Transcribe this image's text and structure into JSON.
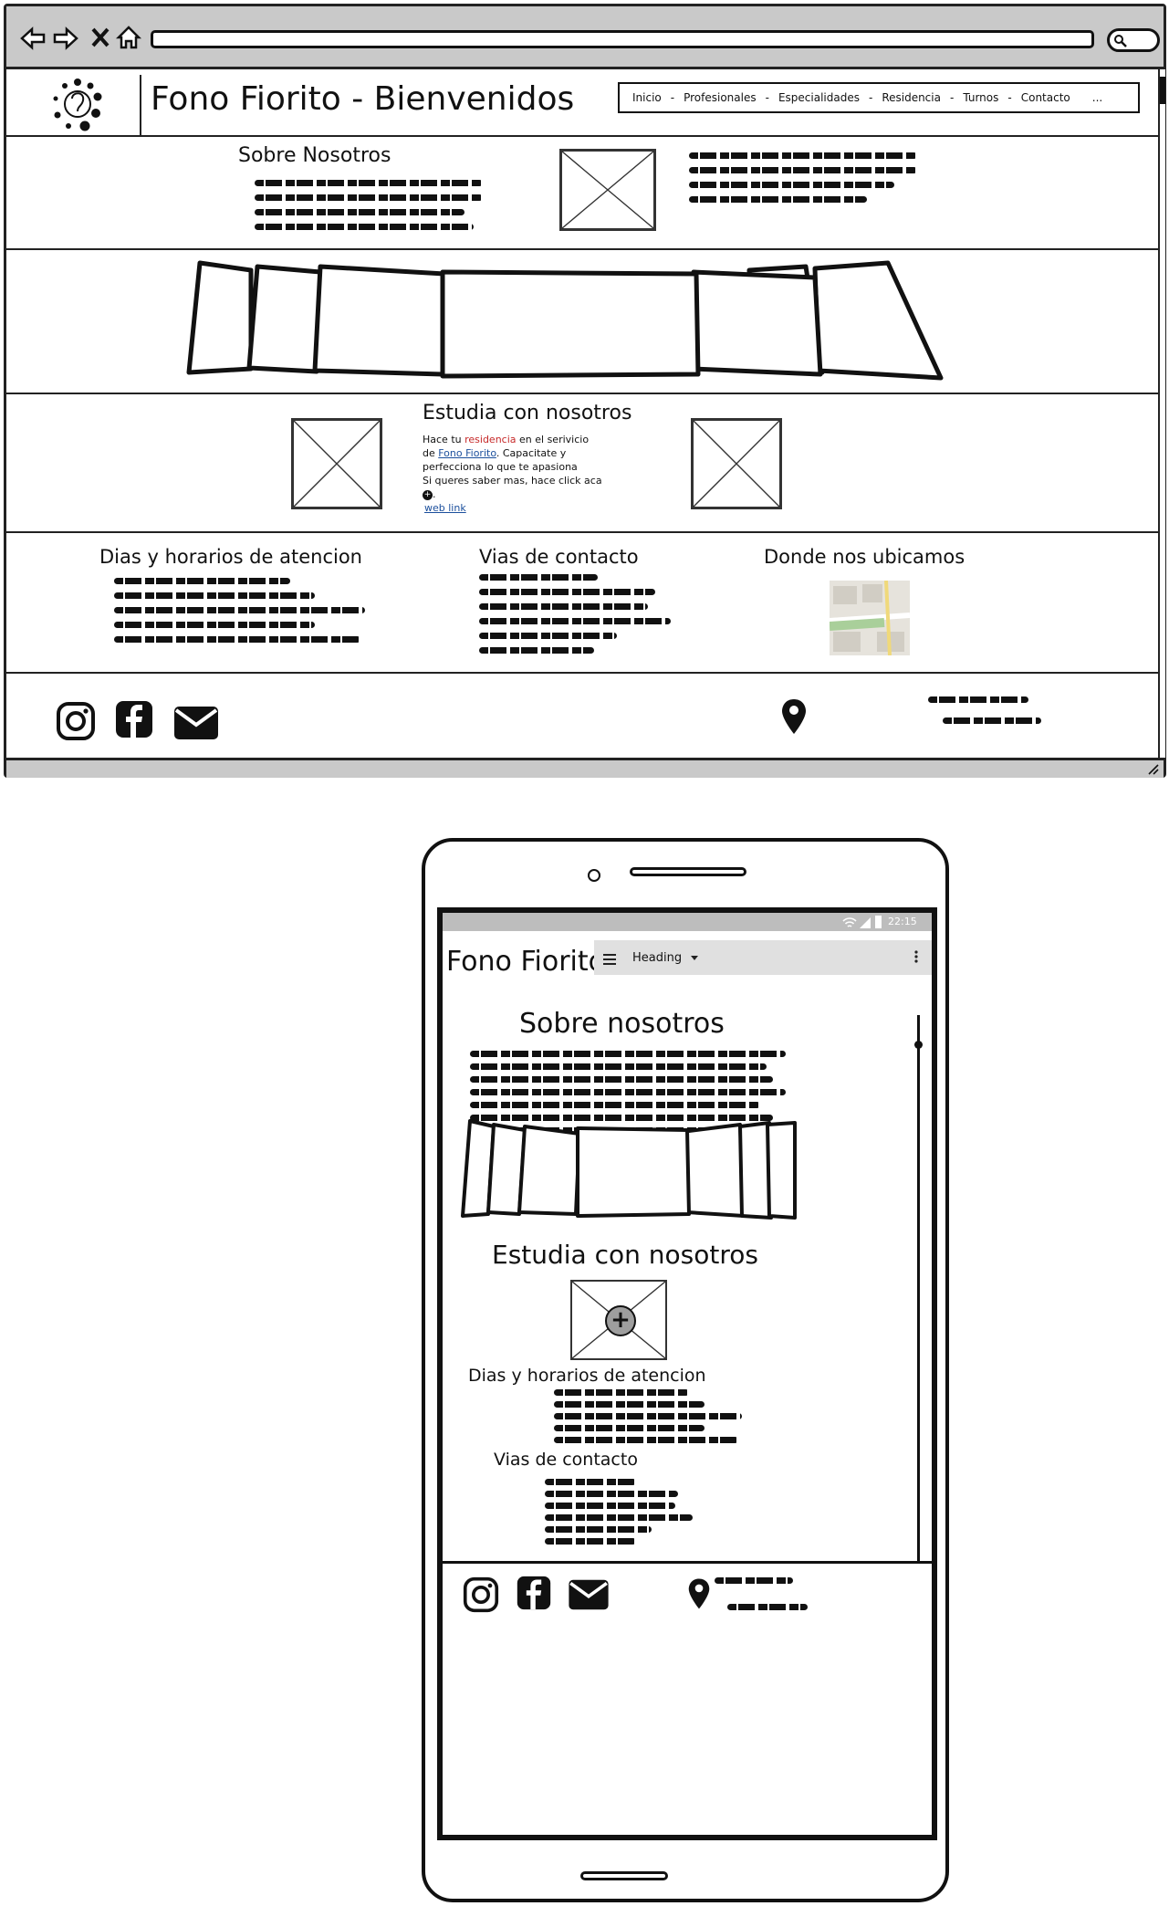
{
  "desktop": {
    "brand_title": "Fono Fiorito - Bienvenidos",
    "nav_items": [
      "Inicio",
      "Profesionales",
      "Especialidades",
      "Residencia",
      "Turnos",
      "Contacto",
      "..."
    ],
    "about": {
      "heading": "Sobre Nosotros"
    },
    "study": {
      "heading": "Estudia con nosotros",
      "line1_pre": "Hace tu ",
      "line1_red": "residencia",
      "line1_post": " en el serivicio",
      "line2_pre": "de ",
      "line2_link": "Fono Fiorito",
      "line2_post": ". Capacitate y",
      "line3": "perfecciona lo que te apasiona",
      "line4": "Si queres saber mas, hace click aca",
      "web_link": "web link"
    },
    "info": {
      "hours_heading": "Dias y horarios de atencion",
      "contact_heading": "Vias de contacto",
      "location_heading": "Donde nos ubicamos"
    }
  },
  "mobile": {
    "brand_title": "Fono Fiorito",
    "status_time": "22:15",
    "toolbar_heading": "Heading",
    "about_heading": "Sobre nosotros",
    "study_heading": "Estudia con nosotros",
    "hours_heading": "Dias y horarios de atencion",
    "contact_heading": "Vias de contacto"
  },
  "colors": {
    "accent_red": "#c62828",
    "link_blue": "#1b4f9c",
    "browser_gray": "#c9c9c9"
  },
  "icons": [
    "back-arrow-icon",
    "forward-arrow-icon",
    "close-icon",
    "home-icon",
    "search-icon",
    "logo-icon",
    "instagram-icon",
    "facebook-icon",
    "mail-icon",
    "map-pin-icon",
    "hamburger-icon",
    "dropdown-caret-icon",
    "kebab-menu-icon",
    "wifi-icon",
    "signal-icon",
    "battery-icon",
    "add-circle-icon"
  ]
}
